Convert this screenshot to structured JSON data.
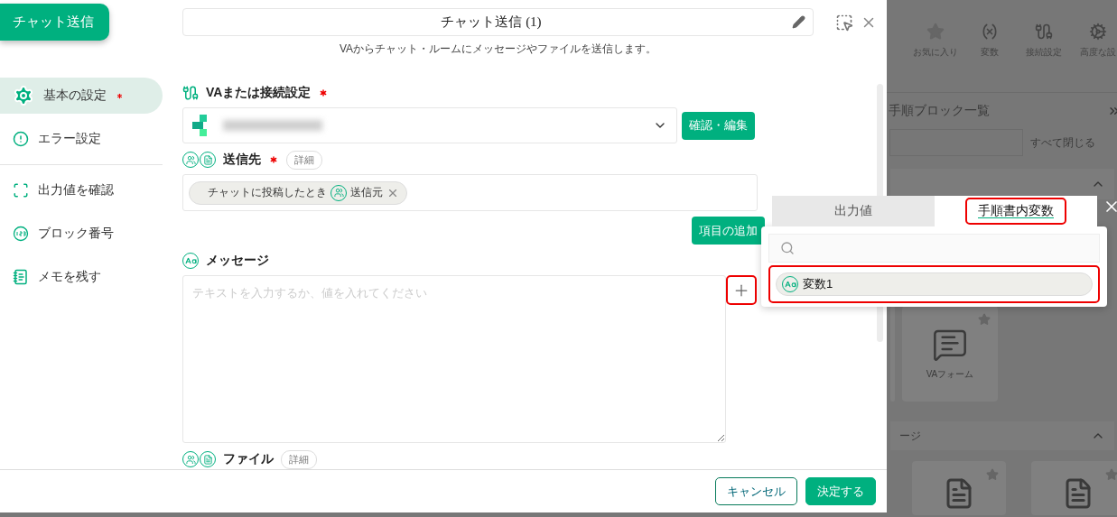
{
  "launcher_button": "チャット送信",
  "sidebar": {
    "groups": [
      [
        {
          "label": "基本の設定",
          "selected": true,
          "required": true
        },
        {
          "label": "エラー設定",
          "selected": false,
          "required": false
        }
      ],
      [
        {
          "label": "出力値を確認",
          "selected": false,
          "required": false
        },
        {
          "label": "ブロック番号",
          "selected": false,
          "required": false
        },
        {
          "label": "メモを残す",
          "selected": false,
          "required": false
        }
      ]
    ]
  },
  "header": {
    "title": "チャット送信 (1)",
    "description": "VAからチャット・ルームにメッセージやファイルを送信します。"
  },
  "sections": [
    {
      "kind": "select",
      "label": "VAまたは接続設定",
      "required": true,
      "button": "確認・編集"
    },
    {
      "kind": "chips",
      "label": "送信先",
      "required": true,
      "detail": "詳細",
      "chips": [
        {
          "text": "チャットに投稿したとき",
          "tag": "送信元"
        }
      ],
      "add_button": "項目の追加"
    },
    {
      "kind": "textarea",
      "label": "メッセージ",
      "required": false,
      "placeholder": "テキストを入力するか、値を入れてください",
      "plus_highlighted": true
    },
    {
      "kind": "file",
      "label": "ファイル",
      "required": false,
      "detail": "詳細"
    }
  ],
  "footer_buttons": [
    {
      "label": "キャンセル",
      "kind": "outline"
    },
    {
      "label": "決定する",
      "kind": "primary"
    }
  ],
  "background": {
    "toolbar": [
      {
        "label": "お気に入り"
      },
      {
        "label": "変数"
      },
      {
        "label": "接続設定"
      },
      {
        "label": "高度な設"
      }
    ],
    "panel_title": "手順ブロック一覧",
    "collapse_all": "すべて閉じる",
    "card": "VAフォーム",
    "group_heading": "ージ"
  },
  "popup": {
    "tabs": [
      {
        "label": "出力値",
        "selected": false,
        "highlighted": false
      },
      {
        "label": "手順書内変数",
        "selected": true,
        "highlighted": true
      }
    ],
    "items": [
      {
        "label": "変数1",
        "highlighted": true
      }
    ]
  }
}
